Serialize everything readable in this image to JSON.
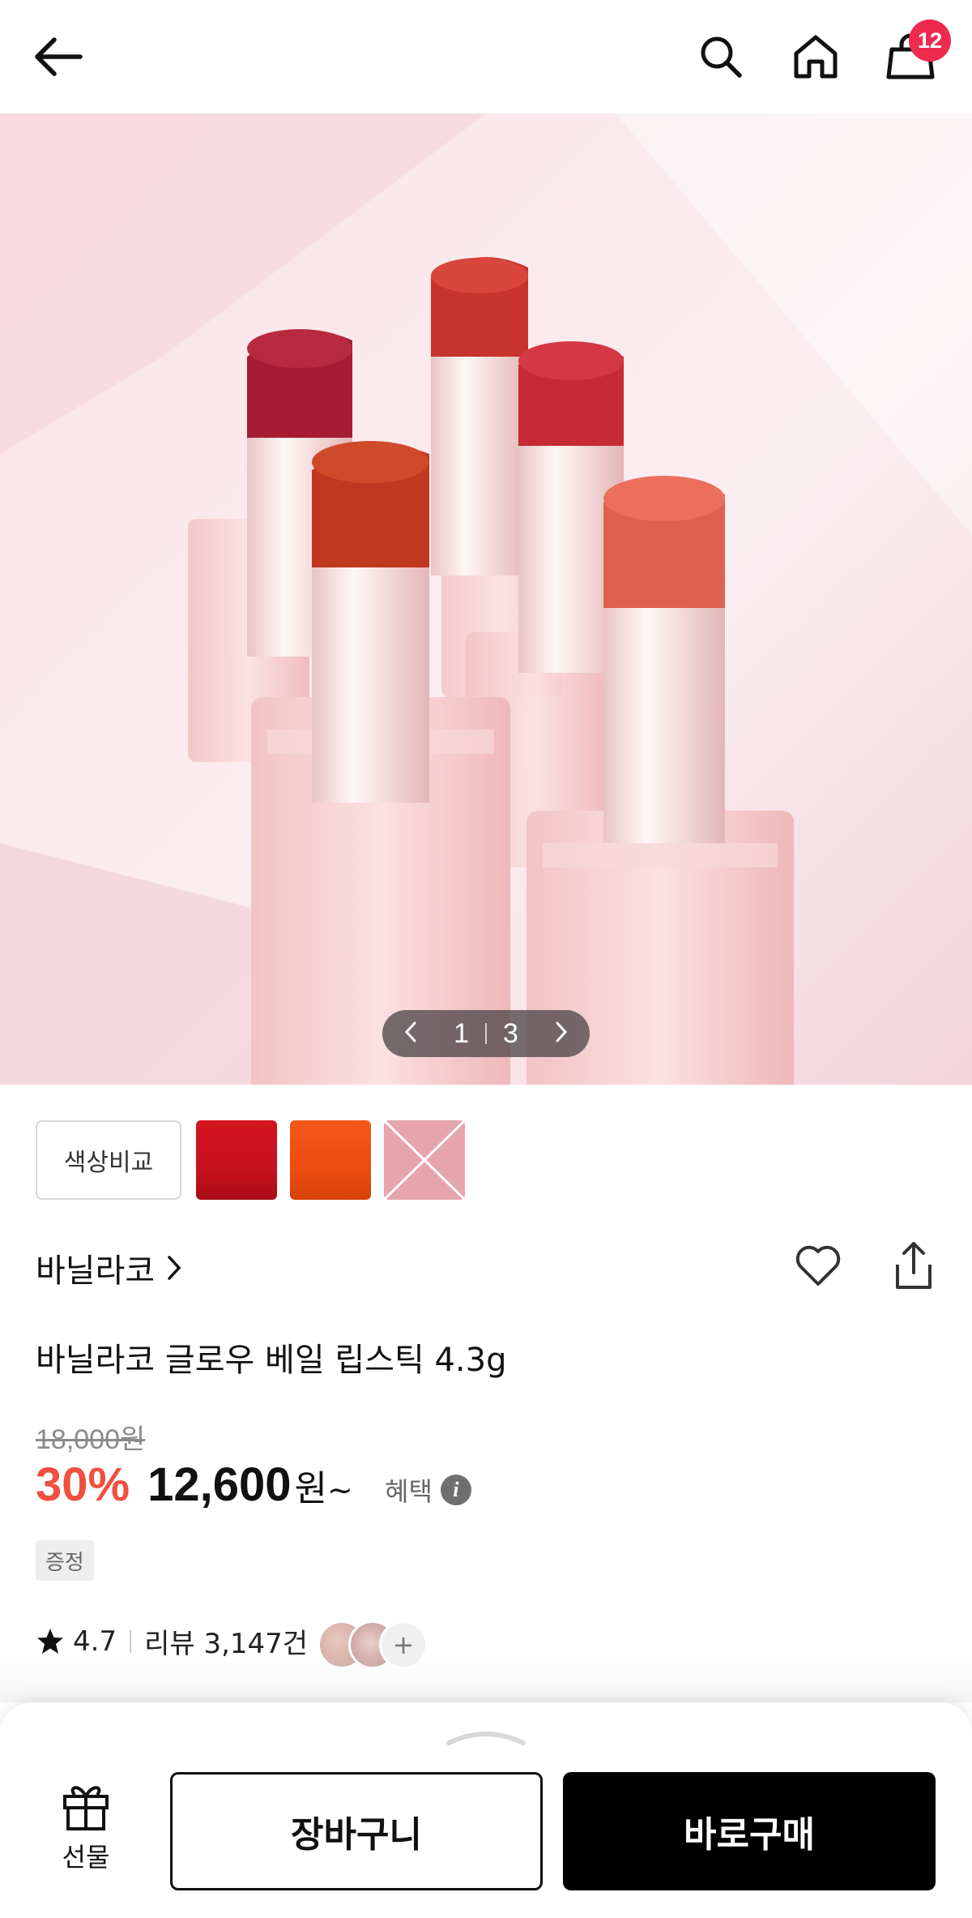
{
  "header": {
    "back_icon": "arrow-left-icon",
    "search_icon": "search-icon",
    "home_icon": "home-icon",
    "cart_icon": "shopping-bag-icon",
    "cart_count": "12"
  },
  "gallery": {
    "current_page": "1",
    "total_pages": "3",
    "prev_icon": "chevron-left-icon",
    "next_icon": "chevron-right-icon"
  },
  "colors": {
    "compare_label": "색상비교",
    "swatch_colors": [
      "#d2141f",
      "#ef4f10",
      "#e6a5ad"
    ]
  },
  "product": {
    "brand": "바닐라코",
    "name": "바닐라코 글로우 베일 립스틱 4.3g",
    "original_price": "18,000원",
    "discount": "30%",
    "sale_price": "12,600",
    "currency": "원",
    "price_suffix": "~",
    "benefit_label": "혜택",
    "gift_tag": "증정",
    "rating": "4.7",
    "review_label": "리뷰 3,147건",
    "more_avatars": "+"
  },
  "actions": {
    "gift_label": "선물",
    "cart_label": "장바구니",
    "buy_label": "바로구매"
  },
  "theme": {
    "badge_color": "#ef2a4f",
    "discount_color": "#ef5040",
    "primary_button": "#000000"
  }
}
